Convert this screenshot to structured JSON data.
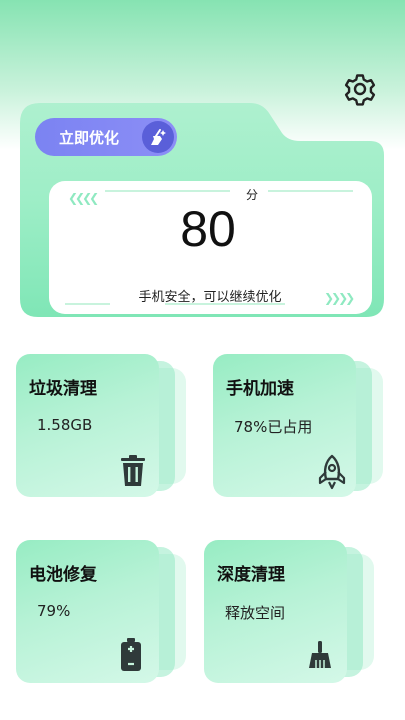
{
  "hero": {
    "optimize_label": "立即优化",
    "score_unit": "分",
    "score": "80",
    "status": "手机安全，可以继续优化"
  },
  "tools": [
    {
      "title": "垃圾清理",
      "value": "1.58GB",
      "icon": "trash-icon"
    },
    {
      "title": "手机加速",
      "value": "78%已占用",
      "icon": "rocket-icon"
    },
    {
      "title": "电池修复",
      "value": "79%",
      "icon": "battery-icon"
    },
    {
      "title": "深度清理",
      "value": "释放空间",
      "icon": "broom-icon"
    }
  ],
  "colors": {
    "accent_green": "#7fe6b6",
    "button_purple": "#7b83f2",
    "icon_dark": "#2f3a3a"
  }
}
